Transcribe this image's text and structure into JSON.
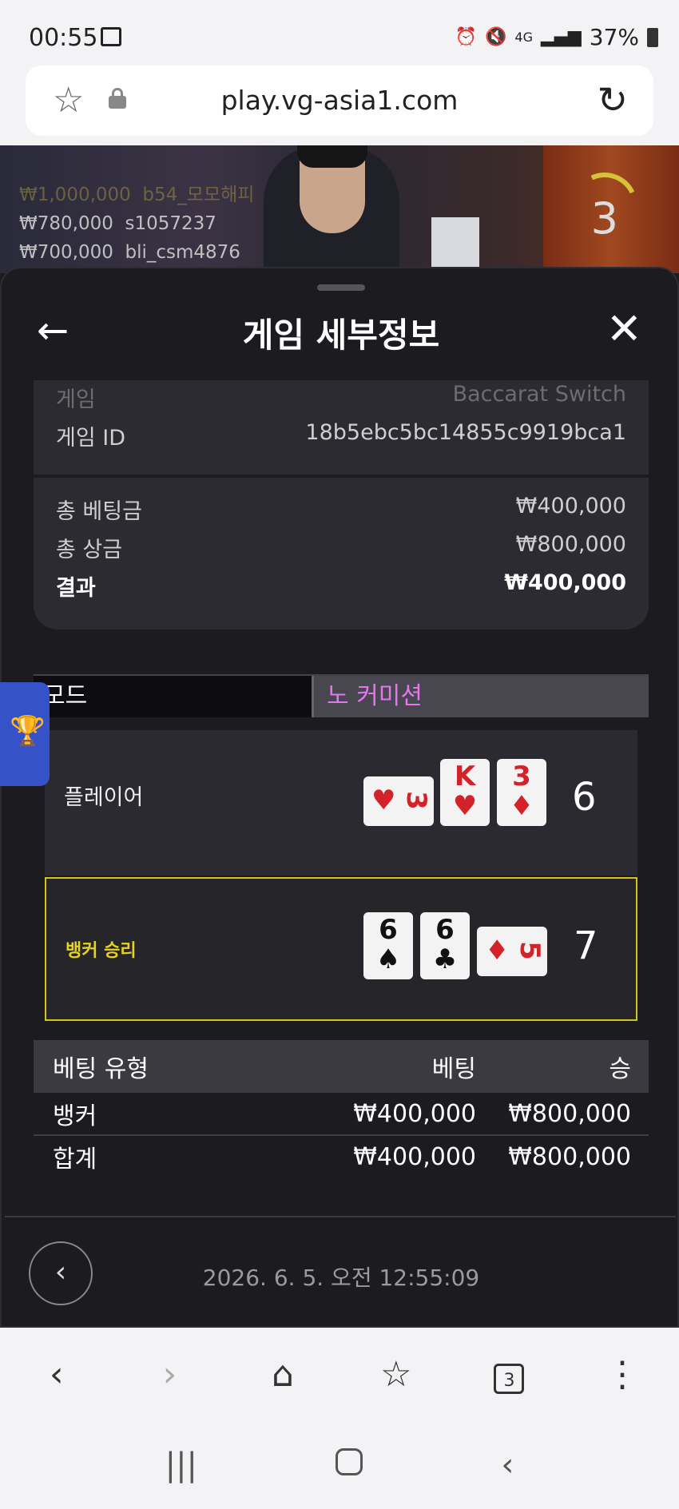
{
  "statusbar": {
    "time": "00:55",
    "network": "4G",
    "battery": "37%"
  },
  "browser": {
    "url": "play.vg-asia1.com"
  },
  "video": {
    "winners": [
      {
        "amount": "₩1,000,000",
        "user": "b54_모모해피",
        "faded": true
      },
      {
        "amount": "₩780,000",
        "user": "s1057237",
        "faded": false
      },
      {
        "amount": "₩700,000",
        "user": "bli_csm4876",
        "faded": false
      }
    ],
    "timer": "3"
  },
  "sheet": {
    "title": "게임 세부정보",
    "info": {
      "game_label": "게임",
      "game_value": "Baccarat Switch",
      "gameid_label": "게임 ID",
      "gameid_value": "18b5ebc5bc14855c9919bca1"
    },
    "totals": {
      "total_bet_label": "총 베팅금",
      "total_bet_value": "₩400,000",
      "total_win_label": "총 상금",
      "total_win_value": "₩800,000",
      "result_label": "결과",
      "result_value": "₩400,000"
    },
    "mode": {
      "label": "모드",
      "value": "노 커미션"
    },
    "player": {
      "label": "플레이어",
      "total": "6",
      "cards": [
        {
          "rank": "3",
          "suit": "♥",
          "color": "red",
          "orientation": "horizontal"
        },
        {
          "rank": "K",
          "suit": "♥",
          "color": "red",
          "orientation": "vertical"
        },
        {
          "rank": "3",
          "suit": "♦",
          "color": "red",
          "orientation": "vertical"
        }
      ]
    },
    "banker": {
      "label": "뱅커 승리",
      "total": "7",
      "cards": [
        {
          "rank": "6",
          "suit": "♠",
          "color": "black",
          "orientation": "vertical"
        },
        {
          "rank": "6",
          "suit": "♣",
          "color": "black",
          "orientation": "vertical"
        },
        {
          "rank": "5",
          "suit": "♦",
          "color": "red",
          "orientation": "horizontal"
        }
      ]
    },
    "bets_table": {
      "headers": [
        "베팅 유형",
        "베팅",
        "승"
      ],
      "rows": [
        [
          "뱅커",
          "₩400,000",
          "₩800,000"
        ],
        [
          "합계",
          "₩400,000",
          "₩800,000"
        ]
      ]
    },
    "datetime": "2026. 6. 5. 오전 12:55:09"
  },
  "colors": {
    "winner_highlight": "#d7c21a",
    "mode_value": "#e277f0",
    "trophy_tab": "#3552c8"
  }
}
